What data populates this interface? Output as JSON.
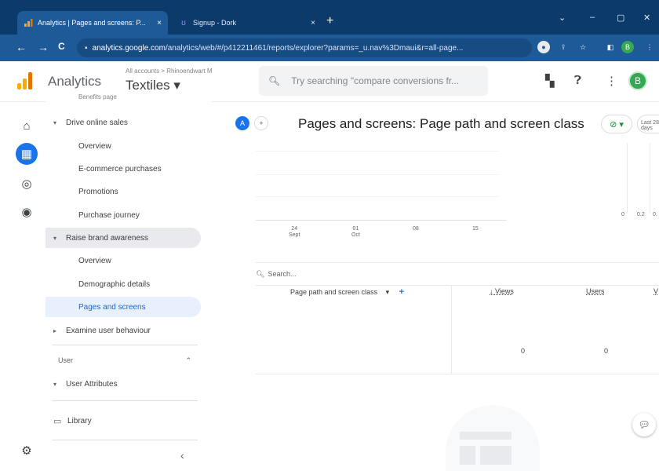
{
  "browser": {
    "tabs": [
      {
        "title": "Analytics | Pages and screens: P...",
        "icon": "analytics-favicon",
        "active": true
      },
      {
        "title": "Signup - Dork",
        "icon": "dork-favicon",
        "active": false
      }
    ],
    "close_glyph": "×",
    "new_tab_glyph": "+",
    "window_controls": [
      "⌄",
      "–",
      "▢",
      "✕"
    ],
    "nav": {
      "back": "←",
      "forward": "→",
      "reload": "C"
    },
    "url_host": "analytics.google.com",
    "url_rest": "/analytics/web/#/p412211461/reports/explorer?params=_u.nav%3Dmaui&r=all-page...",
    "secure_icon": "lock-icon"
  },
  "header": {
    "app_name": "Analytics",
    "breadcrumb": "All accounts > Rhinoendwart M",
    "property": "Textiles ▾",
    "search_placeholder": "Try searching \"compare conversions fr...",
    "avatar_letter": "B",
    "colors": {
      "logo_orange": "#f9ab00",
      "logo_dark": "#e37400",
      "avatar": "#34a853"
    }
  },
  "sidebar": {
    "items": [
      {
        "label": "Benefits page",
        "level": 2,
        "state": "cut"
      },
      {
        "label": "Drive online sales",
        "level": 1,
        "caret": "▾"
      },
      {
        "label": "Overview",
        "level": 2
      },
      {
        "label": "E-commerce purchases",
        "level": 2
      },
      {
        "label": "Promotions",
        "level": 2
      },
      {
        "label": "Purchase journey",
        "level": 2
      },
      {
        "label": "Raise brand awareness",
        "level": 1,
        "caret": "▾",
        "state": "highlight"
      },
      {
        "label": "Overview",
        "level": 2
      },
      {
        "label": "Demographic details",
        "level": 2
      },
      {
        "label": "Pages and screens",
        "level": 2,
        "state": "selected"
      },
      {
        "label": "Examine user behaviour",
        "level": 1,
        "caret": "▸"
      }
    ],
    "user_section": {
      "label": "User",
      "caret": "⌃"
    },
    "user_attributes": {
      "label": "User Attributes",
      "caret": "▾"
    },
    "library": {
      "label": "Library"
    },
    "collapse_glyph": "‹"
  },
  "main": {
    "comparison_pill": "A",
    "add_comparison": "+",
    "title": "Pages and screens: Page path and screen class",
    "status_glyph": "⊘ ▾",
    "cut_button_label": "Last 28 days",
    "chart": {
      "x_ticks": [
        {
          "day": "24",
          "month": "Sept"
        },
        {
          "day": "01",
          "month": "Oct"
        },
        {
          "day": "08",
          "month": ""
        },
        {
          "day": "15",
          "month": ""
        }
      ],
      "right_ticks": [
        "0",
        "0.2",
        "0."
      ]
    },
    "table": {
      "search_placeholder": "Search...",
      "dimension_header": "Page path and screen class",
      "metrics": [
        "↓ Views",
        "Users",
        "V"
      ],
      "row_values": [
        "0",
        "0"
      ]
    }
  }
}
